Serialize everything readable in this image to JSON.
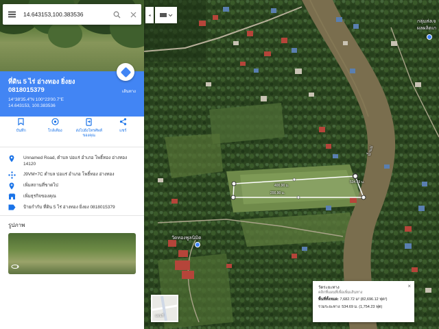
{
  "search": {
    "value": "14.643153,100.383536",
    "search_icon": "search-icon",
    "clear_icon": "close-icon",
    "menu_icon": "menu-icon"
  },
  "place": {
    "name": "ที่ดิน 5 ไร่ อ่างทอง ยิ่งยง",
    "phone": "0818015379",
    "coords_dms": "14°38'35.4\"N 100°23'00.7\"E",
    "coords_decimal": "14.643153, 100.383536",
    "directions_label": "เส้นทาง"
  },
  "actions": [
    {
      "icon": "bookmark-icon",
      "label": "บันทึก"
    },
    {
      "icon": "nearby-icon",
      "label": "ใกล้เคียง"
    },
    {
      "icon": "send-to-phone-icon",
      "label": "ส่งไปยังโทรศัพท์ของคุณ"
    },
    {
      "icon": "share-icon",
      "label": "แชร์"
    }
  ],
  "info": [
    {
      "icon": "location-pin-icon",
      "text": "Unnamed Road, ตำบล บ่อแร่ อำเภอ โพธิ์ทอง อ่างทอง 14120"
    },
    {
      "icon": "plus-code-icon",
      "text": "J9VM+7C ตำบล บ่อแร่ อำเภอ โพธิ์ทอง อ่างทอง"
    },
    {
      "icon": "add-place-icon",
      "text": "เพิ่มสถานที่ขาดไป"
    },
    {
      "icon": "business-icon",
      "text": "เพิ่มธุรกิจของคุณ"
    },
    {
      "icon": "label-icon",
      "text": "ป้ายกำกับ  ที่ดิน 5 ไร่ อ่างทอง ยิ่งยง 0818015379"
    }
  ],
  "photos": {
    "title": "รูปภาพ",
    "icon": "360-photo-icon"
  },
  "map": {
    "layers_icon": "layers-icon",
    "collapse_icon": "chevron-left-icon",
    "minimap_label": "แผนที่",
    "labels": {
      "temple": "วัดทองพูลนิมิต",
      "river": "น้ำแม่",
      "top_right_1": "กลุ่มส่งเจ",
      "top_right_2": "ผลผลิตเก"
    },
    "measure_lines": {
      "top": "400.90 ม.",
      "bottom": "200.90 ม.",
      "right": "534.69 ม."
    }
  },
  "measure": {
    "title": "วัดระยะทาง",
    "subtitle": "คลิกที่แผนที่เพื่อเพิ่มเส้นทาง",
    "area_label": "พื้นที่ทั้งหมด:",
    "area_value": "7,682.72 ม² (82,696.12 ฟุต²)",
    "distance_label": "รวมระยะทาง:",
    "distance_value": "534.69 ม. (1,754.23 ฟุต)"
  },
  "colors": {
    "header_blue": "#4285f4",
    "accent_blue": "#1a73e8",
    "river": "#7a6e4e"
  }
}
